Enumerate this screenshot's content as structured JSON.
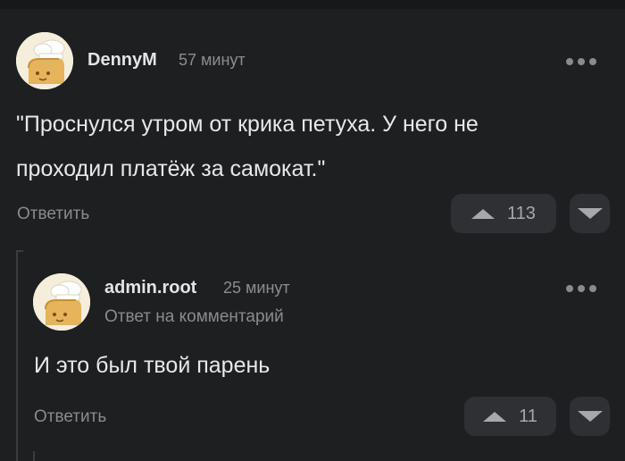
{
  "comments": [
    {
      "username": "DennyM",
      "time": "57 минут",
      "text_lines": [
        "\"Проснулся утром от крика петуха. У него не",
        "проходил платёж за самокат.\""
      ],
      "reply_label": "Ответить",
      "rating": "113",
      "avatar_icon": "chef-bread-avatar-icon",
      "more_icon": "more-dots-icon"
    },
    {
      "username": "admin.root",
      "time": "25 минут",
      "reply_to": "Ответ на комментарий",
      "text_lines": [
        "И это был твой парень"
      ],
      "reply_label": "Ответить",
      "rating": "11",
      "avatar_icon": "chef-bread-avatar-icon",
      "more_icon": "more-dots-icon"
    }
  ],
  "colors": {
    "background": "#1e1f21",
    "button_bg": "#2e3033",
    "muted_text": "#8a8b8e",
    "main_text": "#e8e8e8"
  }
}
